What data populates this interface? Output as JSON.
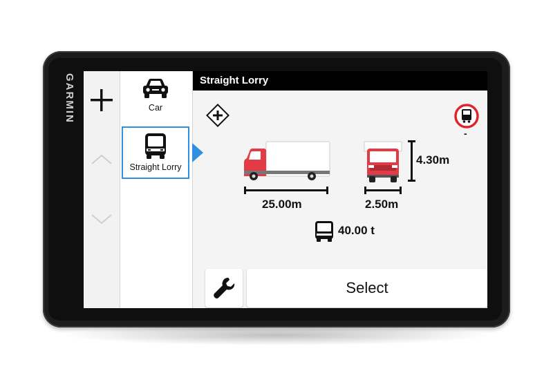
{
  "device": {
    "brand": "GARMIN"
  },
  "header": {
    "title": "Straight Lorry"
  },
  "rail": {
    "add_icon": "plus-icon",
    "up_icon": "chevron-up-icon",
    "down_icon": "chevron-down-icon"
  },
  "vehicles": [
    {
      "label": "Car",
      "icon": "car-icon",
      "selected": false
    },
    {
      "label": "Straight Lorry",
      "icon": "lorry-icon",
      "selected": true
    }
  ],
  "profile": {
    "length": "25.00m",
    "width": "2.50m",
    "height": "4.30m",
    "weight": "40.00 t",
    "restriction_value": "-"
  },
  "buttons": {
    "select": "Select",
    "tools_icon": "wrench-icon"
  },
  "colors": {
    "accent": "#2f8fe0",
    "lorry_red": "#e23b46",
    "restriction_red": "#e0242c"
  }
}
